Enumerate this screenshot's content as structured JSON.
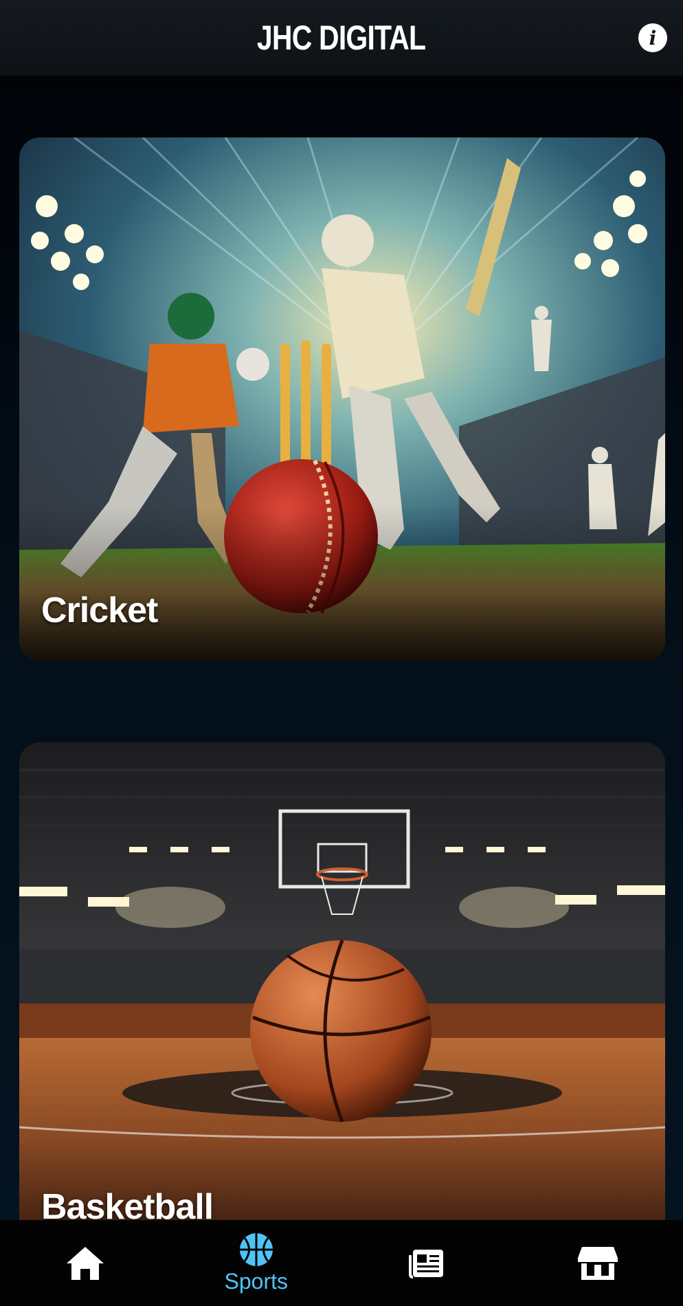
{
  "header": {
    "title": "JHC DIGITAL",
    "info_icon": "info-icon"
  },
  "cards": [
    {
      "label": "Cricket",
      "image": "cricket-players-stadium-illustration"
    },
    {
      "label": "Basketball",
      "image": "basketball-court-arena-illustration"
    }
  ],
  "nav": {
    "items": [
      {
        "icon": "home-icon",
        "label": ""
      },
      {
        "icon": "basketball-icon",
        "label": "Sports",
        "active": true
      },
      {
        "icon": "newspaper-icon",
        "label": ""
      },
      {
        "icon": "store-icon",
        "label": ""
      }
    ]
  },
  "colors": {
    "accent": "#4fc3f7",
    "header_bg": "#151a20",
    "nav_bg": "#030303"
  }
}
